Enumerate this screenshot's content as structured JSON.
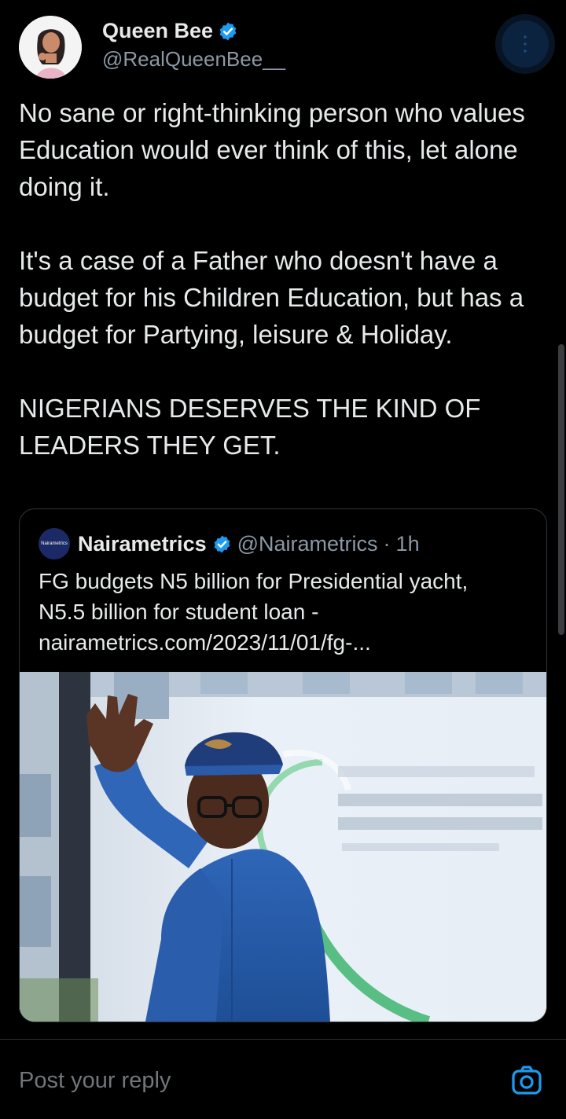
{
  "author": {
    "display_name": "Queen Bee",
    "handle": "@RealQueenBee__",
    "verified": true,
    "avatar_icon": "avatar"
  },
  "tweet": {
    "paragraphs": [
      "No sane or right-thinking person who values Education would ever think of this, let alone doing it.",
      "It's a case of a Father who doesn't have a budget for his Children Education, but has a budget for Partying, leisure & Holiday.",
      "NIGERIANS DESERVES THE KIND OF LEADERS THEY GET."
    ]
  },
  "quote": {
    "avatar_label": "Nairametrics",
    "name": "Nairametrics",
    "handle": "@Nairametrics",
    "separator": "·",
    "time": "1h",
    "text_line1": "FG budgets N5 billion for Presidential yacht,",
    "text_line2": "N5.5 billion for student loan -",
    "text_line3": "nairametrics.com/2023/11/01/fg-..."
  },
  "reply": {
    "placeholder": "Post your reply",
    "camera_icon": "camera-icon"
  },
  "colors": {
    "background": "#000000",
    "text": "#e7e9ea",
    "muted": "#8b98a5",
    "accent": "#1d9bf0",
    "border": "#2f3336"
  }
}
